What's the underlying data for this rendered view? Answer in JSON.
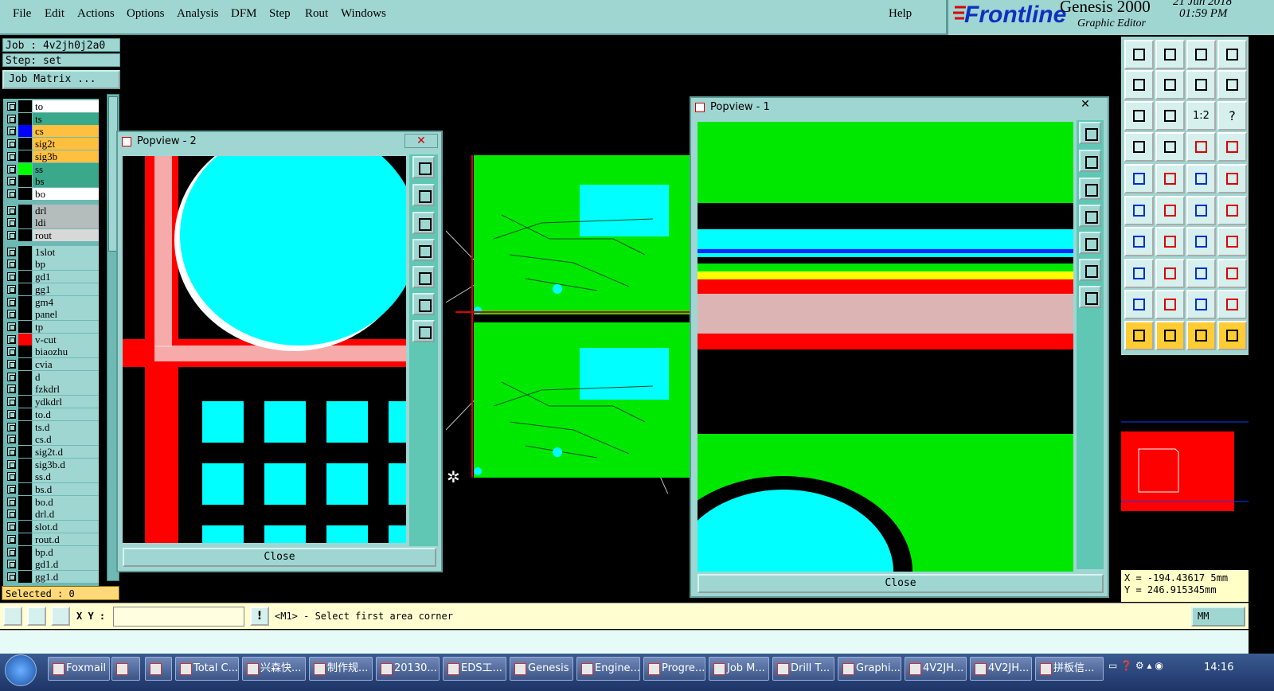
{
  "menu": {
    "items": [
      "File",
      "Edit",
      "Actions",
      "Options",
      "Analysis",
      "DFM",
      "Step",
      "Rout",
      "Windows"
    ],
    "help": "Help"
  },
  "brand": {
    "logo": "Frontline",
    "product": "Genesis 2000",
    "subtitle": "Graphic Editor",
    "date": "21 Jun 2018",
    "time": "01:59 PM"
  },
  "job": {
    "job_label": "Job : 4v2jh0j2a0",
    "step_label": "Step: set",
    "matrix_button": "Job Matrix ..."
  },
  "layers": [
    {
      "name": "to",
      "color": "#ffffff",
      "swatch": "#000000"
    },
    {
      "name": "ts",
      "color": "#3aa88a",
      "swatch": "#000000"
    },
    {
      "name": "cs",
      "color": "#ffc040",
      "swatch": "#0000ff"
    },
    {
      "name": "sig2t",
      "color": "#ffc040",
      "swatch": "#000000"
    },
    {
      "name": "sig3b",
      "color": "#ffc040",
      "swatch": "#000000"
    },
    {
      "name": "ss",
      "color": "#3aa88a",
      "swatch": "#00ff00"
    },
    {
      "name": "bs",
      "color": "#3aa88a",
      "swatch": "#000000"
    },
    {
      "name": "bo",
      "color": "#ffffff",
      "swatch": "#000000"
    },
    {
      "name": "drl",
      "color": "#b4bcbc",
      "swatch": "#000000"
    },
    {
      "name": "ldi",
      "color": "#b4bcbc",
      "swatch": "#000000"
    },
    {
      "name": "rout",
      "color": "#d8d8d8",
      "swatch": "#000000"
    },
    {
      "name": "1slot",
      "color": "#9fd6d2",
      "swatch": "#000000"
    },
    {
      "name": "bp",
      "color": "#9fd6d2",
      "swatch": "#000000"
    },
    {
      "name": "gd1",
      "color": "#9fd6d2",
      "swatch": "#000000"
    },
    {
      "name": "gg1",
      "color": "#9fd6d2",
      "swatch": "#000000"
    },
    {
      "name": "gm4",
      "color": "#9fd6d2",
      "swatch": "#000000"
    },
    {
      "name": "panel",
      "color": "#9fd6d2",
      "swatch": "#000000"
    },
    {
      "name": "tp",
      "color": "#9fd6d2",
      "swatch": "#000000"
    },
    {
      "name": "v-cut",
      "color": "#9fd6d2",
      "swatch": "#ff0000"
    },
    {
      "name": "biaozhu",
      "color": "#9fd6d2",
      "swatch": "#000000"
    },
    {
      "name": "cvia",
      "color": "#9fd6d2",
      "swatch": "#000000"
    },
    {
      "name": "d",
      "color": "#9fd6d2",
      "swatch": "#000000"
    },
    {
      "name": "fzkdrl",
      "color": "#9fd6d2",
      "swatch": "#000000"
    },
    {
      "name": "ydkdrl",
      "color": "#9fd6d2",
      "swatch": "#000000"
    },
    {
      "name": "to.d",
      "color": "#9fd6d2",
      "swatch": "#000000"
    },
    {
      "name": "ts.d",
      "color": "#9fd6d2",
      "swatch": "#000000"
    },
    {
      "name": "cs.d",
      "color": "#9fd6d2",
      "swatch": "#000000"
    },
    {
      "name": "sig2t.d",
      "color": "#9fd6d2",
      "swatch": "#000000"
    },
    {
      "name": "sig3b.d",
      "color": "#9fd6d2",
      "swatch": "#000000"
    },
    {
      "name": "ss.d",
      "color": "#9fd6d2",
      "swatch": "#000000"
    },
    {
      "name": "bs.d",
      "color": "#9fd6d2",
      "swatch": "#000000"
    },
    {
      "name": "bo.d",
      "color": "#9fd6d2",
      "swatch": "#000000"
    },
    {
      "name": "drl.d",
      "color": "#9fd6d2",
      "swatch": "#000000"
    },
    {
      "name": "slot.d",
      "color": "#9fd6d2",
      "swatch": "#000000"
    },
    {
      "name": "rout.d",
      "color": "#9fd6d2",
      "swatch": "#000000"
    },
    {
      "name": "bp.d",
      "color": "#9fd6d2",
      "swatch": "#000000"
    },
    {
      "name": "gd1.d",
      "color": "#9fd6d2",
      "swatch": "#000000"
    },
    {
      "name": "gg1.d",
      "color": "#9fd6d2",
      "swatch": "#000000"
    }
  ],
  "selected": "Selected : 0",
  "popview2": {
    "title": "Popview - 2",
    "close": "Close"
  },
  "popview1": {
    "title": "Popview - 1",
    "close": "Close"
  },
  "toolbox_labels": {
    "ratio": "1:2",
    "help": "?"
  },
  "coords": {
    "x": "X = -194.43617 5mm",
    "y": "Y = 246.915345mm"
  },
  "command": {
    "xy_label": "X Y :",
    "xy_value": "",
    "prompt": "<M1> - Select first area corner",
    "units": "MM"
  },
  "taskbar": {
    "items": [
      "Foxmail",
      "",
      "",
      "Total C...",
      "兴森快...",
      "制作规...",
      "20130...",
      "EDS工...",
      "Genesis",
      "Engine...",
      "Progre...",
      "Job M...",
      "Drill T...",
      "Graphi...",
      "4V2JH...",
      "4V2JH...",
      "拼板信..."
    ],
    "clock": "14:16"
  },
  "colors": {
    "panel": "#9fd6d2",
    "copper": "#00e800",
    "pad": "#00ffff",
    "mask": "#ff0000"
  }
}
